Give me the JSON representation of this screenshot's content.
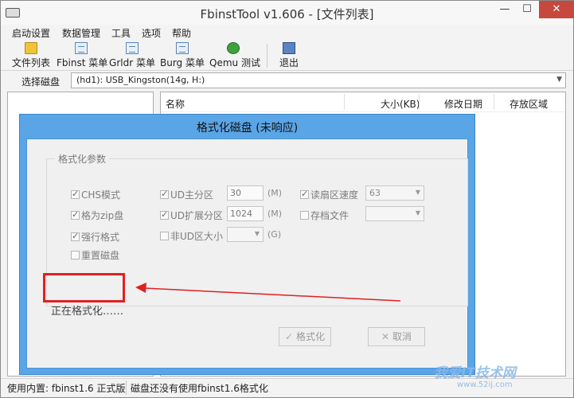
{
  "window": {
    "title": "FbinstTool v1.606 - [文件列表]",
    "controls": {
      "minimize": "—",
      "maximize": "☐",
      "close": "✕"
    }
  },
  "menu": [
    "启动设置",
    "数据管理",
    "工具",
    "选项",
    "帮助"
  ],
  "toolbar": {
    "items": [
      {
        "label": "文件列表",
        "icon": "folder-icon"
      },
      {
        "label": "Fbinst 菜单",
        "icon": "document-icon"
      },
      {
        "label": "Grldr 菜单",
        "icon": "document-icon"
      },
      {
        "label": "Burg 菜单",
        "icon": "document-icon"
      },
      {
        "label": "Qemu 测试",
        "icon": "qemu-icon"
      },
      {
        "label": "退出",
        "icon": "exit-icon"
      }
    ]
  },
  "disk": {
    "label": "选择磁盘",
    "selected": "(hd1): USB_Kingston(14g, H:)"
  },
  "file_list": {
    "columns": [
      "名称",
      "大小(KB)",
      "修改日期",
      "存放区域"
    ]
  },
  "status": {
    "left": "使用内置: fbinst1.6 正式版",
    "right": "磁盘还没有使用fbinst1.6格式化"
  },
  "dialog": {
    "title": "格式化磁盘 (未响应)",
    "group_title": "格式化参数",
    "options": {
      "chs_mode": {
        "label": "CHS模式",
        "checked": true
      },
      "zip_disk": {
        "label": "格为zip盘",
        "checked": true
      },
      "force_format": {
        "label": "强行格式",
        "checked": true
      },
      "reset_disk": {
        "label": "重置磁盘",
        "checked": false
      },
      "ud_primary": {
        "label": "UD主分区",
        "checked": true,
        "value": "30",
        "unit": "(M)"
      },
      "ud_extended": {
        "label": "UD扩展分区",
        "checked": true,
        "value": "1024",
        "unit": "(M)"
      },
      "non_ud_size": {
        "label": "非UD区大小",
        "checked": false,
        "value": "",
        "unit": "(G)"
      },
      "read_sector_speed": {
        "label": "读扇区速度",
        "checked": true,
        "value": "63"
      },
      "archive_file": {
        "label": "存档文件",
        "checked": false,
        "value": ""
      }
    },
    "progress": "正在格式化……",
    "format_button": "格式化",
    "cancel_button": "取消"
  },
  "watermark": {
    "text": "我爱IT技术网",
    "url": "www.52ij.com"
  },
  "colors": {
    "dialog_border": "#5aa5e6",
    "close_button": "#c7483c",
    "annotation": "#e02020"
  }
}
